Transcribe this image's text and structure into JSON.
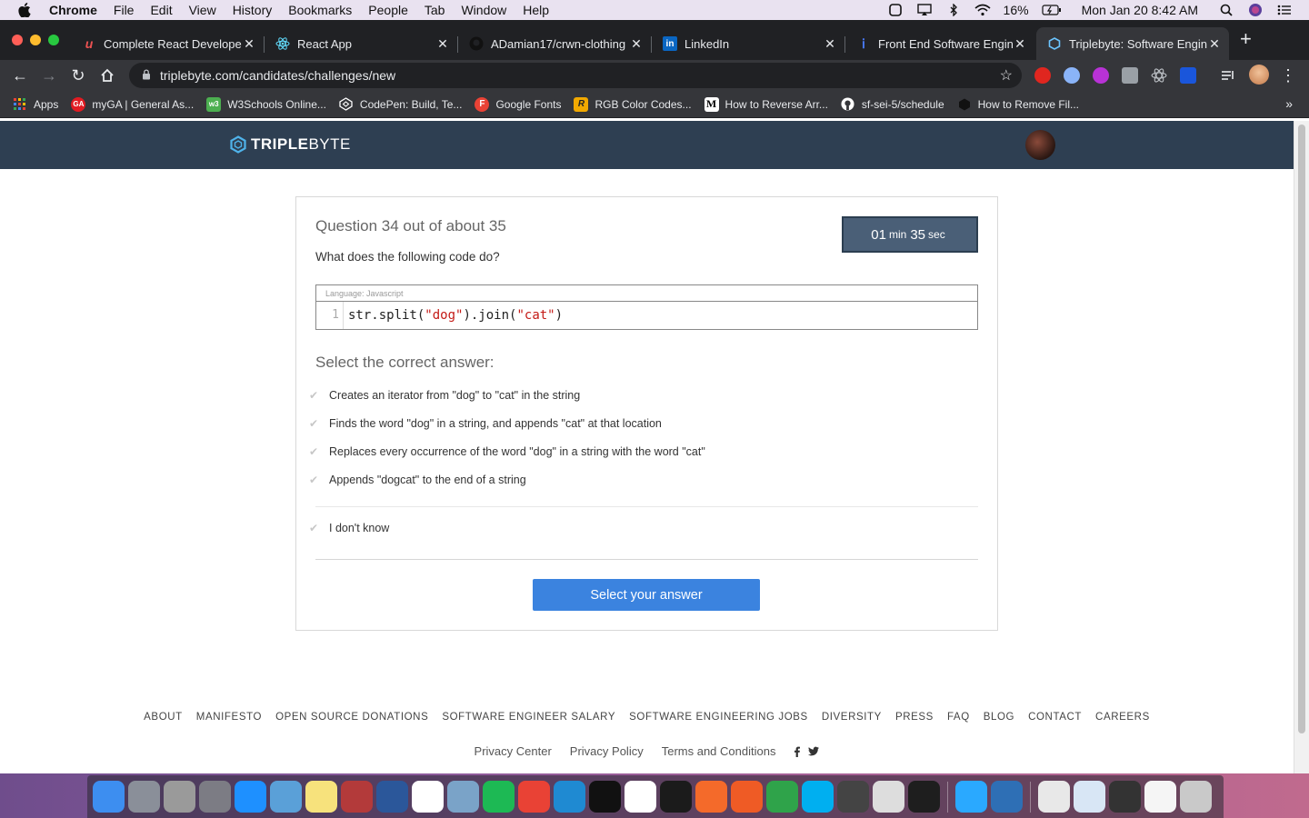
{
  "menubar": {
    "app_name": "Chrome",
    "menus": [
      "File",
      "Edit",
      "View",
      "History",
      "Bookmarks",
      "People",
      "Tab",
      "Window",
      "Help"
    ],
    "battery": "16%",
    "clock": "Mon Jan 20  8:42 AM"
  },
  "tabs": [
    {
      "title": "Complete React Developer i",
      "favicon": "udemy-icon",
      "active": false
    },
    {
      "title": "React App",
      "favicon": "react-icon",
      "active": false
    },
    {
      "title": "ADamian17/crwn-clothing",
      "favicon": "github-icon",
      "active": false
    },
    {
      "title": "LinkedIn",
      "favicon": "linkedin-icon",
      "active": false
    },
    {
      "title": "Front End Software Enginee",
      "favicon": "info-icon",
      "active": false
    },
    {
      "title": "Triplebyte: Software Engine",
      "favicon": "triplebyte-icon",
      "active": true
    }
  ],
  "omnibox": {
    "url": "triplebyte.com/candidates/challenges/new"
  },
  "bookmarks": [
    {
      "label": "Apps",
      "icon": "apps-grid-icon",
      "color": "#e94235"
    },
    {
      "label": "myGA | General As...",
      "icon": "ga-icon",
      "color": "#e21b22"
    },
    {
      "label": "W3Schools Online...",
      "icon": "w3schools-icon",
      "color": "#4caf50"
    },
    {
      "label": "CodePen: Build, Te...",
      "icon": "codepen-icon",
      "color": "#ffffff"
    },
    {
      "label": "Google Fonts",
      "icon": "google-fonts-icon",
      "color": "#e94235"
    },
    {
      "label": "RGB Color Codes...",
      "icon": "rgb-icon",
      "color": "#f2a900"
    },
    {
      "label": "How to Reverse Arr...",
      "icon": "medium-icon",
      "color": "#ffffff"
    },
    {
      "label": "sf-sei-5/schedule",
      "icon": "github-icon",
      "color": "#ffffff"
    },
    {
      "label": "How to Remove Fil...",
      "icon": "hex-icon",
      "color": "#111111"
    }
  ],
  "site": {
    "logo_bold": "TRIPLE",
    "logo_light": "BYTE",
    "accent": "#3b83df",
    "header_bg": "#2e3f52"
  },
  "question": {
    "title": "Question 34 out of about 35",
    "timer": {
      "minutes": "01",
      "min_label": "min",
      "seconds": "35",
      "sec_label": "sec"
    },
    "prompt": "What does the following code do?",
    "code_language": "Language: Javascript",
    "code_line_number": "1",
    "code": {
      "p1": "str.split(",
      "s1": "\"dog\"",
      "p2": ").join(",
      "s2": "\"cat\"",
      "p3": ")"
    },
    "select_heading": "Select the correct answer:",
    "answers": [
      "Creates an iterator from \"dog\" to \"cat\" in the string",
      "Finds the word \"dog\" in a string, and appends \"cat\" at that location",
      "Replaces every occurrence of the word \"dog\" in a string with the word \"cat\"",
      "Appends \"dogcat\" to the end of a string"
    ],
    "dont_know": "I don't know",
    "submit_label": "Select your answer"
  },
  "footer": {
    "links": [
      "ABOUT",
      "MANIFESTO",
      "OPEN SOURCE DONATIONS",
      "SOFTWARE ENGINEER SALARY",
      "SOFTWARE ENGINEERING JOBS",
      "DIVERSITY",
      "PRESS",
      "FAQ",
      "BLOG",
      "CONTACT",
      "CAREERS"
    ],
    "legal": [
      "Privacy Center",
      "Privacy Policy",
      "Terms and Conditions"
    ],
    "social": [
      "facebook-icon",
      "twitter-icon"
    ]
  },
  "dock": {
    "apps": [
      {
        "name": "finder-icon",
        "color": "#3d8ef0"
      },
      {
        "name": "launchpad-icon",
        "color": "#8a8f99"
      },
      {
        "name": "system-utility-icon",
        "color": "#9a9a9a"
      },
      {
        "name": "system-preferences-icon",
        "color": "#7c7c84"
      },
      {
        "name": "app-store-icon",
        "color": "#1e90ff"
      },
      {
        "name": "preview-icon",
        "color": "#5aa0d8"
      },
      {
        "name": "notes-icon",
        "color": "#f7e27c"
      },
      {
        "name": "dictionary-icon",
        "color": "#b33a3a"
      },
      {
        "name": "word-icon",
        "color": "#2b579a"
      },
      {
        "name": "calendar-icon",
        "color": "#ffffff"
      },
      {
        "name": "image-capture-icon",
        "color": "#7aa3c8"
      },
      {
        "name": "spotify-icon",
        "color": "#1db954"
      },
      {
        "name": "chrome-icon",
        "color": "#e94235"
      },
      {
        "name": "vscode-icon",
        "color": "#1f8ad2"
      },
      {
        "name": "terminal-icon",
        "color": "#111111"
      },
      {
        "name": "slack-icon",
        "color": "#ffffff"
      },
      {
        "name": "activity-monitor-icon",
        "color": "#1b1b1b"
      },
      {
        "name": "sublime-icon",
        "color": "#f46a2a"
      },
      {
        "name": "postman-icon",
        "color": "#ef5b25"
      },
      {
        "name": "rocket-icon",
        "color": "#2fa34a"
      },
      {
        "name": "skype-icon",
        "color": "#00aff0"
      },
      {
        "name": "printer-icon",
        "color": "#444444"
      },
      {
        "name": "textedit-icon",
        "color": "#dddddd"
      },
      {
        "name": "figma-icon",
        "color": "#1e1e1e"
      },
      {
        "name": "messages-icon",
        "color": "#2aa9ff"
      },
      {
        "name": "quicktime-icon",
        "color": "#2e6fb5"
      },
      {
        "name": "window-1-icon",
        "color": "#e8e8e8"
      },
      {
        "name": "window-2-icon",
        "color": "#d8e6f5"
      },
      {
        "name": "window-3-icon",
        "color": "#333333"
      },
      {
        "name": "window-4-icon",
        "color": "#f5f5f5"
      },
      {
        "name": "trash-icon",
        "color": "#c9c9c9"
      }
    ]
  }
}
